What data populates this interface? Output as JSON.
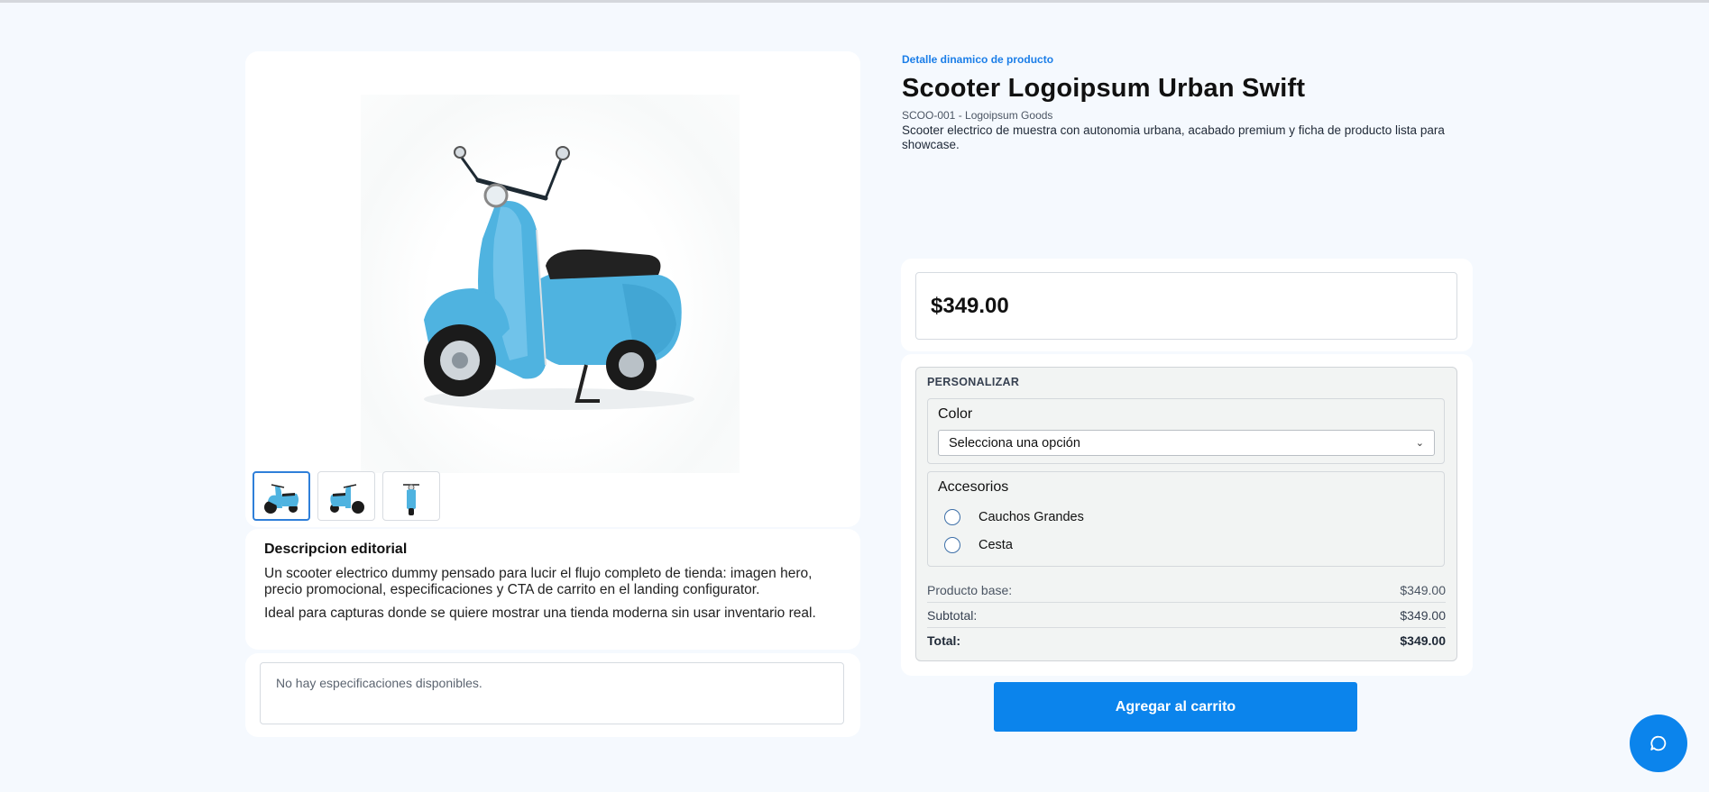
{
  "page": {
    "eyebrow": "Detalle dinamico de producto",
    "title": "Scooter Logoipsum Urban Swift",
    "sku_line": "SCOO-001 - Logoipsum Goods",
    "summary": "Scooter electrico de muestra con autonomia urbana, acabado premium y ficha de producto lista para showcase."
  },
  "gallery": {
    "hero_icon": "blue-scooter-image",
    "thumbnails": [
      {
        "name": "scooter-thumbnail-1",
        "active": true
      },
      {
        "name": "scooter-thumbnail-2",
        "active": false
      },
      {
        "name": "scooter-thumbnail-3",
        "active": false
      }
    ]
  },
  "description": {
    "title": "Descripcion editorial",
    "paragraphs": [
      "Un scooter electrico dummy pensado para lucir el flujo completo de tienda: imagen hero, precio promocional, especificaciones y CTA de carrito en el landing configurator.",
      "Ideal para capturas donde se quiere mostrar una tienda moderna sin usar inventario real."
    ]
  },
  "specs": {
    "empty_text": "No hay especificaciones disponibles."
  },
  "price": {
    "value": "$349.00"
  },
  "customize": {
    "label": "PERSONALIZAR",
    "color": {
      "title": "Color",
      "selected": "Selecciona una opción"
    },
    "accessories": {
      "title": "Accesorios",
      "options": [
        {
          "label": "Cauchos Grandes",
          "checked": false
        },
        {
          "label": "Cesta",
          "checked": false
        }
      ]
    },
    "totals": {
      "base_label": "Producto base:",
      "base_value": "$349.00",
      "subtotal_label": "Subtotal:",
      "subtotal_value": "$349.00",
      "total_label": "Total:",
      "total_value": "$349.00"
    }
  },
  "actions": {
    "add_to_cart": "Agregar al carrito",
    "chat_icon": "chat-bubble-icon"
  },
  "colors": {
    "accent": "#0b84ec",
    "eyebrow": "#1b7ee8",
    "background": "#f5f9fe",
    "scooter": "#4fb3e0"
  }
}
